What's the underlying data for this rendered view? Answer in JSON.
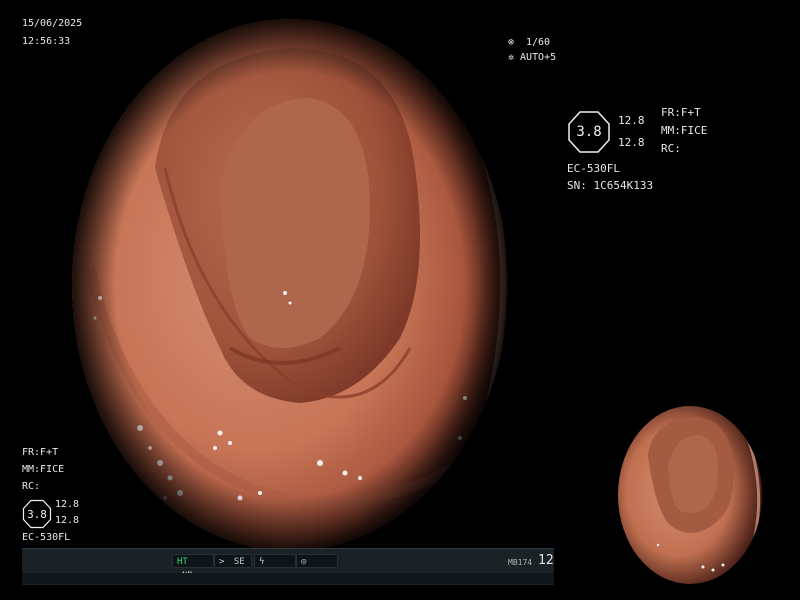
{
  "header": {
    "date": "15/06/2025",
    "time": "12:56:33"
  },
  "shutter": {
    "icon": "shutter-icon",
    "speed": "1/60",
    "iris_icon": "iris-icon",
    "iris": "AUTO+5"
  },
  "settings_right": {
    "hex_value": "3.8",
    "value_a": "12.8",
    "value_b": "12.8",
    "fr": "FR:F+T",
    "mm": "MM:FICE",
    "rc": "RC:",
    "scope": "EC-530FL",
    "serial": "SN: 1C654K133"
  },
  "settings_left": {
    "fr": "FR:F+T",
    "mm": "MM:FICE",
    "rc": "RC:",
    "hex_value": "3.8",
    "value_a": "12.8",
    "value_b": "12.8",
    "scope": "EC-530FL"
  },
  "status_bar": {
    "ht": "HT",
    "nr": "NR",
    "se_icon": "contrast-icon",
    "se": "SE",
    "zoom_icon": "lightning-icon",
    "mode_icon": "circle-mode-icon",
    "id": "MB174",
    "number": "12"
  },
  "colors": {
    "tissue_light": "#d98a6c",
    "tissue_mid": "#b8614a",
    "tissue_dark": "#6e2a1f",
    "status_green": "#3fd07a"
  }
}
